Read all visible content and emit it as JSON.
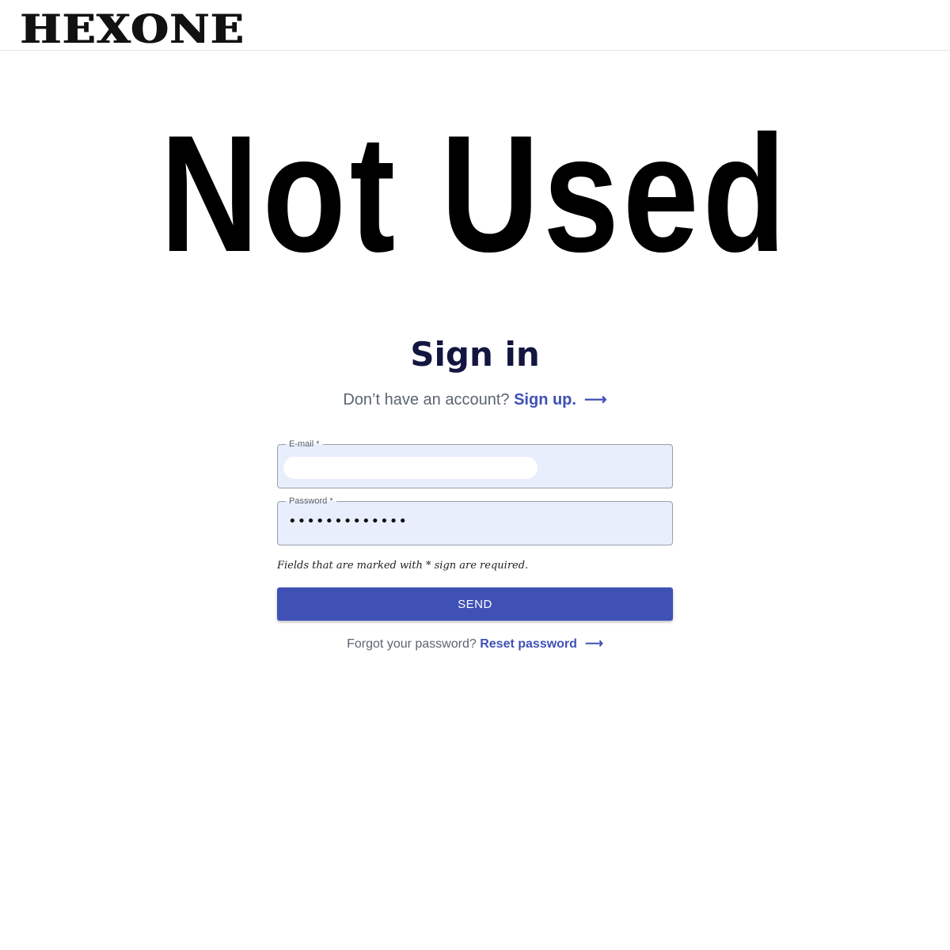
{
  "header": {
    "logo_text": "HEXONE"
  },
  "hero": {
    "text": "Not Used"
  },
  "signin": {
    "title": "Sign in",
    "no_account_text": "Don’t have an account?",
    "signup_link": "Sign up.",
    "arrow": "⟶"
  },
  "form": {
    "email_label": "E-mail *",
    "email_value": "",
    "password_label": "Password *",
    "password_value": "•••••••••••••",
    "required_note": "Fields that are marked with * sign are required.",
    "send_label": "SEND"
  },
  "forgot": {
    "text": "Forgot your password?",
    "reset_link": "Reset password",
    "arrow": "⟶"
  },
  "colors": {
    "accent": "#3f51b5",
    "title": "#13163f",
    "field_bg": "#e8eefc"
  }
}
